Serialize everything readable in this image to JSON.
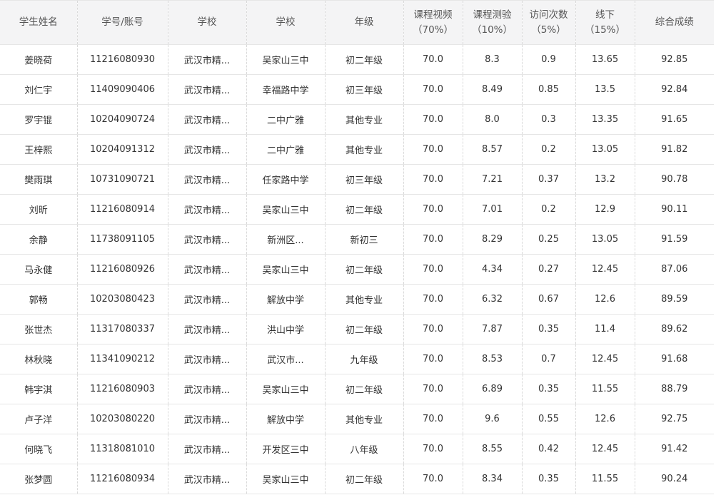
{
  "table": {
    "headers": [
      {
        "lines": [
          "学生姓名"
        ]
      },
      {
        "lines": [
          "学号/账号"
        ]
      },
      {
        "lines": [
          "学校"
        ]
      },
      {
        "lines": [
          "学校"
        ]
      },
      {
        "lines": [
          "年级"
        ]
      },
      {
        "lines": [
          "课程视频",
          "（70%）"
        ]
      },
      {
        "lines": [
          "课程测验",
          "（10%）"
        ]
      },
      {
        "lines": [
          "访问次数",
          "（5%）"
        ]
      },
      {
        "lines": [
          "线下",
          "（15%）"
        ]
      },
      {
        "lines": [
          "综合成绩"
        ]
      }
    ],
    "rows": [
      [
        "姜晓荷",
        "11216080930",
        "武汉市精...",
        "吴家山三中",
        "初二年级",
        "70.0",
        "8.3",
        "0.9",
        "13.65",
        "92.85"
      ],
      [
        "刘仁宇",
        "11409090406",
        "武汉市精...",
        "幸福路中学",
        "初三年级",
        "70.0",
        "8.49",
        "0.85",
        "13.5",
        "92.84"
      ],
      [
        "罗宇锟",
        "10204090724",
        "武汉市精...",
        "二中广雅",
        "其他专业",
        "70.0",
        "8.0",
        "0.3",
        "13.35",
        "91.65"
      ],
      [
        "王梓熙",
        "10204091312",
        "武汉市精...",
        "二中广雅",
        "其他专业",
        "70.0",
        "8.57",
        "0.2",
        "13.05",
        "91.82"
      ],
      [
        "樊雨琪",
        "10731090721",
        "武汉市精...",
        "任家路中学",
        "初三年级",
        "70.0",
        "7.21",
        "0.37",
        "13.2",
        "90.78"
      ],
      [
        "刘昕",
        "11216080914",
        "武汉市精...",
        "吴家山三中",
        "初二年级",
        "70.0",
        "7.01",
        "0.2",
        "12.9",
        "90.11"
      ],
      [
        "余静",
        "11738091105",
        "武汉市精...",
        "新洲区...",
        "新初三",
        "70.0",
        "8.29",
        "0.25",
        "13.05",
        "91.59"
      ],
      [
        "马永健",
        "11216080926",
        "武汉市精...",
        "吴家山三中",
        "初二年级",
        "70.0",
        "4.34",
        "0.27",
        "12.45",
        "87.06"
      ],
      [
        "郭畅",
        "10203080423",
        "武汉市精...",
        "解放中学",
        "其他专业",
        "70.0",
        "6.32",
        "0.67",
        "12.6",
        "89.59"
      ],
      [
        "张世杰",
        "11317080337",
        "武汉市精...",
        "洪山中学",
        "初二年级",
        "70.0",
        "7.87",
        "0.35",
        "11.4",
        "89.62"
      ],
      [
        "林秋晓",
        "11341090212",
        "武汉市精...",
        "武汉市...",
        "九年级",
        "70.0",
        "8.53",
        "0.7",
        "12.45",
        "91.68"
      ],
      [
        "韩宇淇",
        "11216080903",
        "武汉市精...",
        "吴家山三中",
        "初二年级",
        "70.0",
        "6.89",
        "0.35",
        "11.55",
        "88.79"
      ],
      [
        "卢子洋",
        "10203080220",
        "武汉市精...",
        "解放中学",
        "其他专业",
        "70.0",
        "9.6",
        "0.55",
        "12.6",
        "92.75"
      ],
      [
        "何晓飞",
        "11318081010",
        "武汉市精...",
        "开发区三中",
        "八年级",
        "70.0",
        "8.55",
        "0.42",
        "12.45",
        "91.42"
      ],
      [
        "张梦圆",
        "11216080934",
        "武汉市精...",
        "吴家山三中",
        "初二年级",
        "70.0",
        "8.34",
        "0.35",
        "11.55",
        "90.24"
      ]
    ]
  },
  "colors": {
    "header_background": "#f4f4f5",
    "border": "#e6e6e6",
    "text": "#333333"
  }
}
